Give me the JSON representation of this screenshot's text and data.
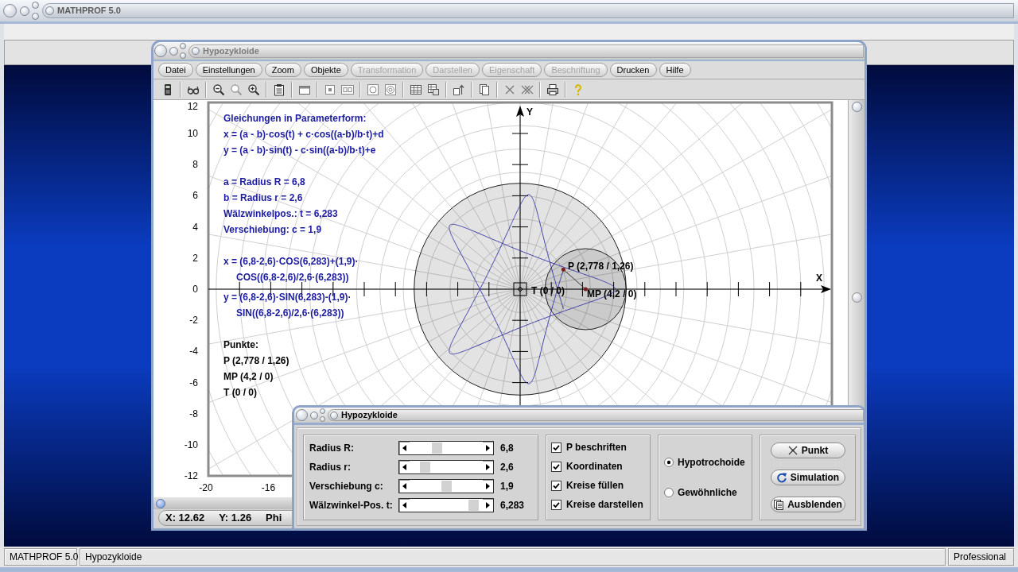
{
  "main_window": {
    "title": "MATHPROF 5.0"
  },
  "window": {
    "title": "Hypozykloide",
    "menu": [
      {
        "label": "Datei",
        "disabled": false
      },
      {
        "label": "Einstellungen",
        "disabled": false
      },
      {
        "label": "Zoom",
        "disabled": false
      },
      {
        "label": "Objekte",
        "disabled": false
      },
      {
        "label": "Transformation",
        "disabled": true
      },
      {
        "label": "Darstellen",
        "disabled": true
      },
      {
        "label": "Eigenschaft",
        "disabled": true
      },
      {
        "label": "Beschriftung",
        "disabled": true
      },
      {
        "label": "Drucken",
        "disabled": false
      },
      {
        "label": "Hilfe",
        "disabled": false
      }
    ],
    "plot": {
      "y_ticks": [
        "12",
        "10",
        "8",
        "6",
        "4",
        "2",
        "0",
        "-2",
        "-4",
        "-6",
        "-8",
        "-10",
        "-12"
      ],
      "x_ticks": [
        "-20",
        "-16"
      ],
      "x_axis_title": "X",
      "y_axis_title": "Y",
      "legend": {
        "title": "Gleichungen in Parameterform:",
        "equations": [
          "x = (a - b)·cos(t) + c·cos((a-b)/b·t)+d",
          "y = (a - b)·sin(t) - c·sin((a-b)/b·t)+e"
        ],
        "parameters": [
          "a = Radius R = 6,8",
          "b = Radius r = 2,6",
          "Wälzwinkelpos.: t = 6,283",
          "Verschiebung: c = 1,9"
        ],
        "substituted": [
          [
            "x = (6,8-2,6)·COS(6,283)+(1,9)·",
            "COS((6,8-2,6)/2,6·(6,283))"
          ],
          [
            "y = (6,8-2,6)·SIN(6,283)-(1,9)·",
            "SIN((6,8-2,6)/2,6·(6,283))"
          ]
        ],
        "points_title": "Punkte:",
        "points": [
          "P (2,778 / 1,26)",
          "MP (4,2 / 0)",
          "T (0 / 0)"
        ]
      },
      "point_labels": [
        "P (2,778 / 1,26)",
        "MP (4,2 / 0)",
        "T (0 / 0)"
      ]
    },
    "status": [
      "X: 12.62",
      "Y: 1.26",
      "Phi"
    ]
  },
  "dialog": {
    "title": "Hypozykloide",
    "sliders": [
      {
        "label": "Radius R:",
        "level": 0.36,
        "value": "6,8"
      },
      {
        "label": "Radius r:",
        "level": 0.16,
        "value": "2,6"
      },
      {
        "label": "Verschiebung c:",
        "level": 0.5,
        "value": "1,9"
      },
      {
        "label": "Wälzwinkel-Pos. t:",
        "level": 0.94,
        "value": "6,283"
      }
    ],
    "checkboxes": [
      {
        "label": "P beschriften",
        "checked": true
      },
      {
        "label": "Koordinaten",
        "checked": true
      },
      {
        "label": "Kreise füllen",
        "checked": true
      },
      {
        "label": "Kreise darstellen",
        "checked": true
      }
    ],
    "radios": [
      {
        "label": "Hypotrochoide",
        "selected": true
      },
      {
        "label": "Gewöhnliche",
        "selected": false
      }
    ],
    "buttons": [
      "Punkt",
      "Simulation",
      "Ausblenden"
    ]
  },
  "status_bar": [
    "MATHPROF 5.0",
    "Hypozykloide",
    "Professional"
  ]
}
